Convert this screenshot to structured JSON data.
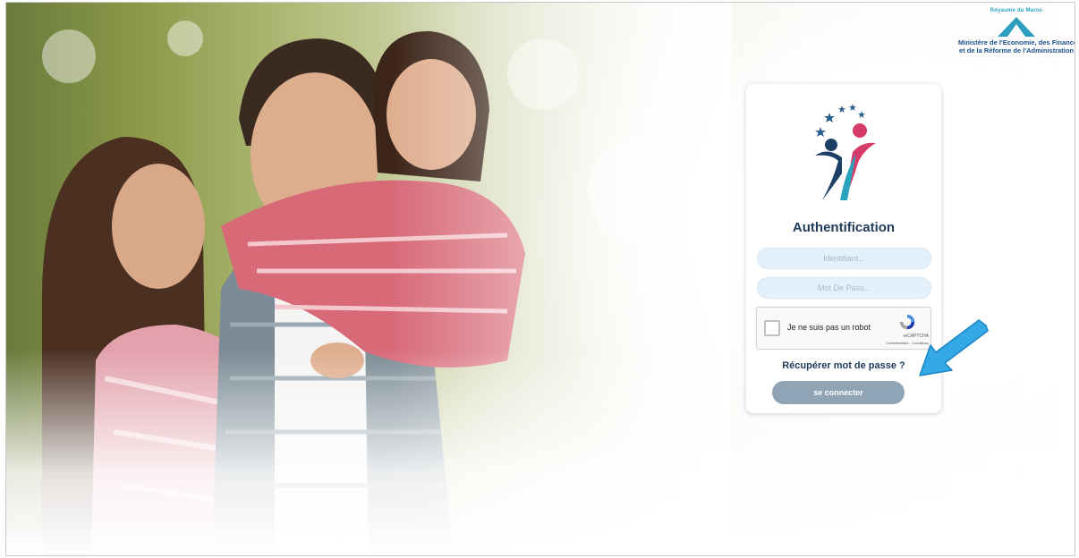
{
  "ministry_logo": {
    "kingdom": "Royaume du Maroc",
    "line1": "Ministère de l'Economie, des Finances",
    "line2": "et de la Réforme de l'Administration"
  },
  "login": {
    "title": "Authentification",
    "username_placeholder": "Identifiant...",
    "password_placeholder": "Mot De Pass...",
    "captcha_label": "Je ne suis pas un robot",
    "captcha_brand": "reCAPTCHA",
    "captcha_links": "Confidentialité - Conditions",
    "recover_link": "Récupérer mot de passe ?",
    "connect_button": "se connecter"
  },
  "colors": {
    "title": "#1f3b5a",
    "field_bg": "#e4f0fa",
    "button_bg": "#8fa5b6",
    "arrow": "#35a9e6"
  },
  "icons": {
    "app_logo": "family-logo-icon",
    "annotation": "arrow-pointer-icon"
  }
}
